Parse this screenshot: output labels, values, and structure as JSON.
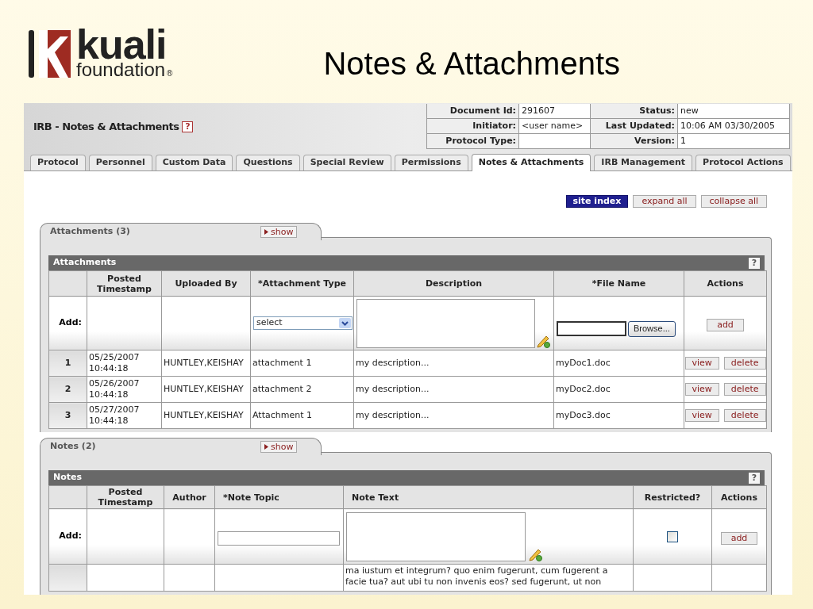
{
  "slide": {
    "logo": {
      "name": "kuali",
      "tagline": "foundation",
      "mark": "®"
    },
    "title": "Notes & Attachments"
  },
  "screen": {
    "page_title": "IRB - Notes & Attachments",
    "help": "?",
    "doc_info": [
      {
        "label": "Document Id:",
        "value": "291607"
      },
      {
        "label": "Status:",
        "value": "new"
      },
      {
        "label": "Initiator:",
        "value": "<user name>"
      },
      {
        "label": "Last Updated:",
        "value": "10:06 AM 03/30/2005"
      },
      {
        "label": "Protocol Type:"
      },
      {
        "label": "Version:",
        "value": "1"
      }
    ],
    "tabs": [
      {
        "label": "Protocol",
        "selected": false
      },
      {
        "label": "Personnel",
        "selected": false
      },
      {
        "label": "Custom Data",
        "selected": false
      },
      {
        "label": "Questions",
        "selected": false
      },
      {
        "label": "Special Review",
        "selected": false
      },
      {
        "label": "Permissions",
        "selected": false
      },
      {
        "label": "Notes & Attachments",
        "selected": true
      },
      {
        "label": "IRB Management",
        "selected": false
      },
      {
        "label": "Protocol Actions",
        "selected": false
      }
    ],
    "nav_buttons": [
      {
        "label": "site index",
        "kind": "primary"
      },
      {
        "label": "expand all",
        "kind": "plain"
      },
      {
        "label": "collapse all",
        "kind": "plain"
      }
    ],
    "attachments": {
      "tab_label": "Attachments (3)",
      "show_button": "show",
      "header": "Attachments",
      "help": "?",
      "columns": [
        "Posted Timestamp",
        "Uploaded By",
        "*Attachment Type",
        "Description",
        "*File Name",
        "Actions"
      ],
      "add_row": {
        "label": "Add:",
        "type_select": "select",
        "browse_button": "Browse...",
        "add_button": "add"
      },
      "rows": [
        {
          "number": "1",
          "timestamp": "05/25/2007 10:44:18",
          "uploaded_by": "HUNTLEY,KEISHAY",
          "type": "attachment 1",
          "description": "my description...",
          "file_name": "myDoc1.doc",
          "actions": [
            "view",
            "delete"
          ]
        },
        {
          "number": "2",
          "timestamp": "05/26/2007 10:44:18",
          "uploaded_by": "HUNTLEY,KEISHAY",
          "type": "attachment 2",
          "description": "my description...",
          "file_name": "myDoc2.doc",
          "actions": [
            "view",
            "delete"
          ]
        },
        {
          "number": "3",
          "timestamp": "05/27/2007 10:44:18",
          "uploaded_by": "HUNTLEY,KEISHAY",
          "type": "Attachment 1",
          "description": "my description...",
          "file_name": "myDoc3.doc",
          "actions": [
            "view",
            "delete"
          ]
        }
      ]
    },
    "notes": {
      "tab_label": "Notes (2)",
      "show_button": "show",
      "header": "Notes",
      "help": "?",
      "columns": [
        "Posted Timestamp",
        "Author",
        "*Note Topic",
        "Note Text",
        "Restricted?",
        "Actions"
      ],
      "add_row": {
        "label": "Add:",
        "restricted_checked": false,
        "add_button": "add"
      },
      "rows": [
        {
          "note_text": "ma iustum et integrum? quo enim fugerunt, cum fugerent a facie tua? aut ubi tu non invenis eos? sed fugerunt, ut non"
        }
      ]
    }
  }
}
